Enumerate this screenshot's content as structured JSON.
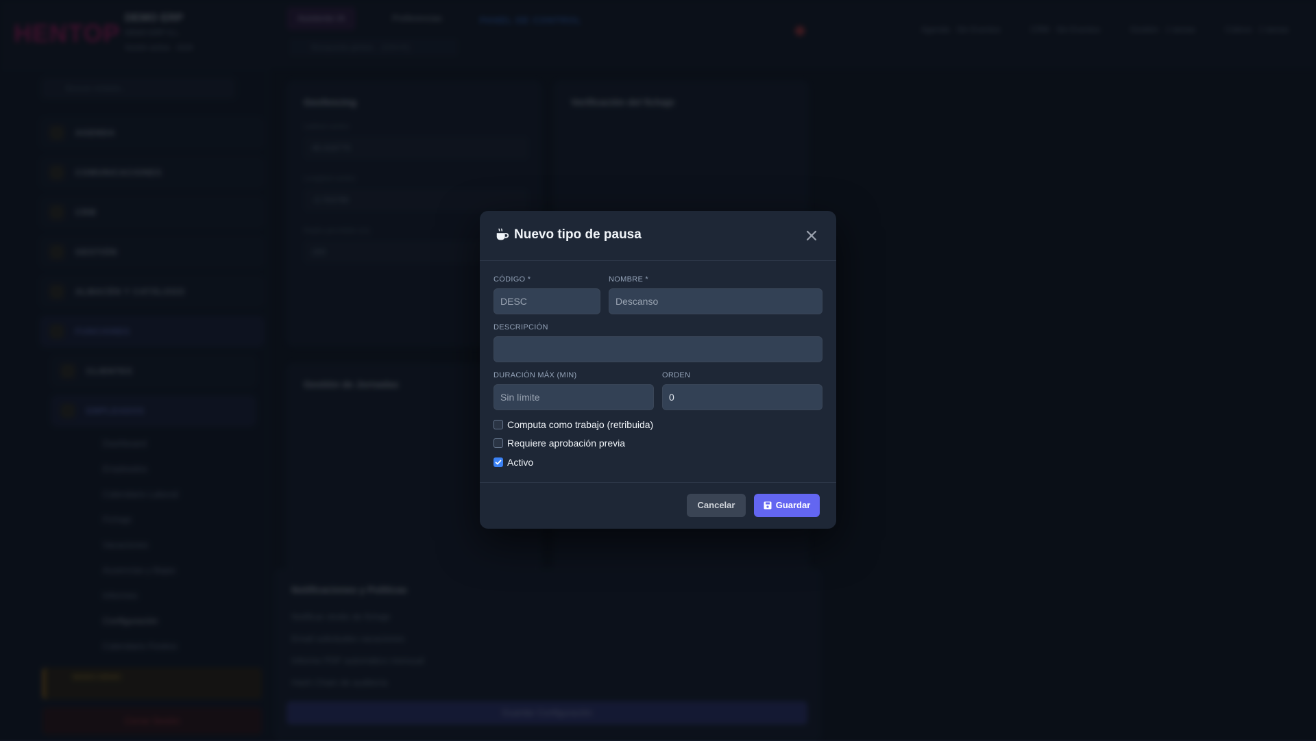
{
  "background": {
    "logo": "HENTOP",
    "company_name": "DEMO ERP",
    "company_sub": "DEMO ERP S.L.",
    "session": "Sesión activa · 2026",
    "tab_ai": "Asistente IA",
    "tab_prefs": "Preferencias",
    "search_placeholder": "Búsqueda global... (Ctrl+K)",
    "panel_title": "PANEL DE CONTROL",
    "stats": [
      "Agenda · Sin Eventos",
      "CRM · Sin Eventos",
      "Gestión · 1 tareas",
      "Cobros · 1 tareas"
    ],
    "sidebar_search": "Buscar módulo...",
    "sidebar_items": [
      "AGENDA",
      "COMUNICACIONES",
      "CRM",
      "GESTIÓN",
      "ALMACÉN Y CATÁLOGO",
      "FUNCIONES",
      "CLIENTES",
      "EMPLEADOS"
    ],
    "sidebar_subitems": [
      "Dashboard",
      "Empleados",
      "Calendario Laboral",
      "Fichaje",
      "Vacaciones",
      "Ausencias y Bajas",
      "Informes",
      "Configuración",
      "Calendario Festivo"
    ],
    "demo_label": "MODO DEMO",
    "logout": "Cerrar Sesión",
    "card_geofencing": "Geofencing",
    "card_verification": "Verificación del fichaje",
    "card_jornadas": "Gestión de Jornadas",
    "card_notif": "Notificaciones y Políticas",
    "field_lat": "40.416775",
    "field_lng": "-3.703790",
    "field_radius": "200",
    "label_lat": "Latitud centro",
    "label_lng": "Longitud centro",
    "label_radius": "Radio permitido (m)",
    "notif_lines": [
      "Notificar olvido de fichaje",
      "Email solicitudes vacaciones",
      "Informe PDF automático mensual",
      "Hash Chain de auditoría"
    ],
    "save_config": "Guardar Configuración"
  },
  "modal": {
    "title": "Nuevo tipo de pausa",
    "close_label": "×",
    "fields": {
      "codigo_label": "CÓDIGO *",
      "codigo_placeholder": "DESC",
      "nombre_label": "NOMBRE *",
      "nombre_placeholder": "Descanso",
      "descripcion_label": "DESCRIPCIÓN",
      "descripcion_value": "",
      "duracion_label": "DURACIÓN MÁX (MIN)",
      "duracion_placeholder": "Sin límite",
      "orden_label": "ORDEN",
      "orden_value": "0"
    },
    "checkboxes": [
      {
        "label": "Computa como trabajo (retribuida)",
        "checked": false
      },
      {
        "label": "Requiere aprobación previa",
        "checked": false
      },
      {
        "label": "Activo",
        "checked": true
      }
    ],
    "buttons": {
      "cancel": "Cancelar",
      "save": "Guardar"
    }
  },
  "colors": {
    "accent": "#6366f1",
    "checkbox_checked": "#3b82f6",
    "modal_bg": "#1e2736"
  }
}
